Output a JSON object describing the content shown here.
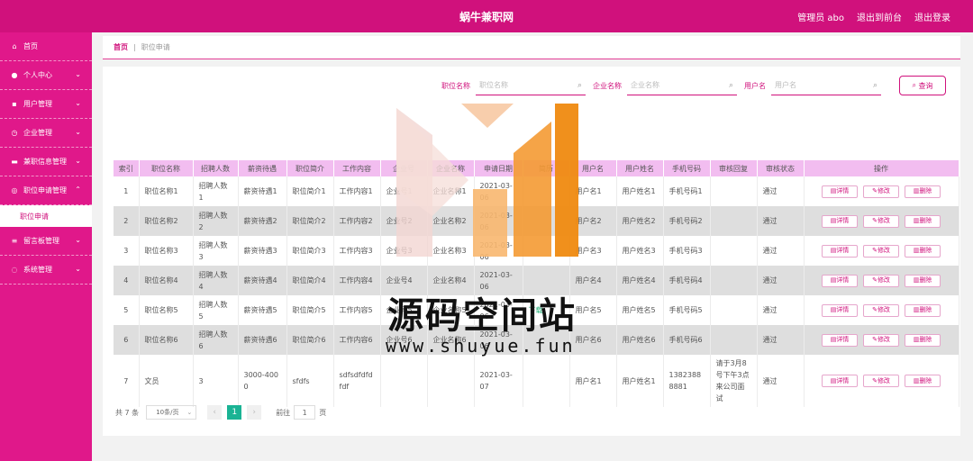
{
  "header": {
    "title": "蜗牛兼职网",
    "user": "管理员 abo",
    "to_frontend": "退出到前台",
    "logout": "退出登录"
  },
  "sidebar": {
    "items": [
      {
        "label": "首页",
        "icon": "home-icon"
      },
      {
        "label": "个人中心",
        "icon": "user-icon",
        "chev": "⌄"
      },
      {
        "label": "用户管理",
        "icon": "id-card-icon",
        "chev": "⌄"
      },
      {
        "label": "企业管理",
        "icon": "clock-icon",
        "chev": "⌄"
      },
      {
        "label": "兼职信息管理",
        "icon": "briefcase-icon",
        "chev": "⌄"
      },
      {
        "label": "职位申请管理",
        "icon": "target-icon",
        "chev": "⌃"
      },
      {
        "label": "留言板管理",
        "icon": "list-icon",
        "chev": "⌄"
      },
      {
        "label": "系统管理",
        "icon": "power-icon",
        "chev": "⌄"
      }
    ],
    "sub_item": "职位申请"
  },
  "breadcrumb": {
    "home": "首页",
    "sep": "|",
    "current": "职位申请"
  },
  "search": {
    "field1_label": "职位名称",
    "field1_placeholder": "职位名称",
    "field2_label": "企业名称",
    "field2_placeholder": "企业名称",
    "field3_label": "用户名",
    "field3_placeholder": "用户名",
    "button": "查询"
  },
  "table": {
    "headers": [
      "索引",
      "职位名称",
      "招聘人数",
      "薪资待遇",
      "职位简介",
      "工作内容",
      "企业号",
      "企业名称",
      "申请日期",
      "简历",
      "用户名",
      "用户姓名",
      "手机号码",
      "审核回复",
      "审核状态",
      "操作"
    ],
    "rows": [
      [
        "1",
        "职位名称1",
        "招聘人数1",
        "薪资待遇1",
        "职位简介1",
        "工作内容1",
        "企业号1",
        "企业名称1",
        "2021-03-06",
        "",
        "用户名1",
        "用户姓名1",
        "手机号码1",
        "",
        "通过"
      ],
      [
        "2",
        "职位名称2",
        "招聘人数2",
        "薪资待遇2",
        "职位简介2",
        "工作内容2",
        "企业号2",
        "企业名称2",
        "2021-03-06",
        "",
        "用户名2",
        "用户姓名2",
        "手机号码2",
        "",
        "通过"
      ],
      [
        "3",
        "职位名称3",
        "招聘人数3",
        "薪资待遇3",
        "职位简介3",
        "工作内容3",
        "企业号3",
        "企业名称3",
        "2021-03-06",
        "",
        "用户名3",
        "用户姓名3",
        "手机号码3",
        "",
        "通过"
      ],
      [
        "4",
        "职位名称4",
        "招聘人数4",
        "薪资待遇4",
        "职位简介4",
        "工作内容4",
        "企业号4",
        "企业名称4",
        "2021-03-06",
        "",
        "用户名4",
        "用户姓名4",
        "手机号码4",
        "",
        "通过"
      ],
      [
        "5",
        "职位名称5",
        "招聘人数5",
        "薪资待遇5",
        "职位简介5",
        "工作内容5",
        "企业号5",
        "企业名称5",
        "2021-03-06",
        "下载",
        "用户名5",
        "用户姓名5",
        "手机号码5",
        "",
        "通过"
      ],
      [
        "6",
        "职位名称6",
        "招聘人数6",
        "薪资待遇6",
        "职位简介6",
        "工作内容6",
        "企业号6",
        "企业名称6",
        "2021-03-06",
        "",
        "用户名6",
        "用户姓名6",
        "手机号码6",
        "",
        "通过"
      ],
      [
        "7",
        "文员",
        "3",
        "3000-4000",
        "sfdfs",
        "sdfsdfdfdfdf",
        "",
        "",
        "2021-03-07",
        "",
        "用户名1",
        "用户姓名1",
        "13823888881",
        "请于3月8号下午3点来公司面试",
        "通过"
      ]
    ],
    "actions": {
      "detail": "详情",
      "edit": "修改",
      "delete": "删除"
    }
  },
  "pager": {
    "total": "共 7 条",
    "page_size": "10条/页",
    "prev": "‹",
    "page": "1",
    "next": "›",
    "goto_prefix": "前往",
    "goto_value": "1",
    "goto_suffix": "页"
  },
  "watermark": {
    "text": "源码空间站",
    "url": "www.shuyue.fun"
  },
  "colors": {
    "brand": "#d0117c",
    "sidebar": "#e0188a",
    "table_header": "#f2bdf0",
    "accent_green": "#1ab394"
  }
}
